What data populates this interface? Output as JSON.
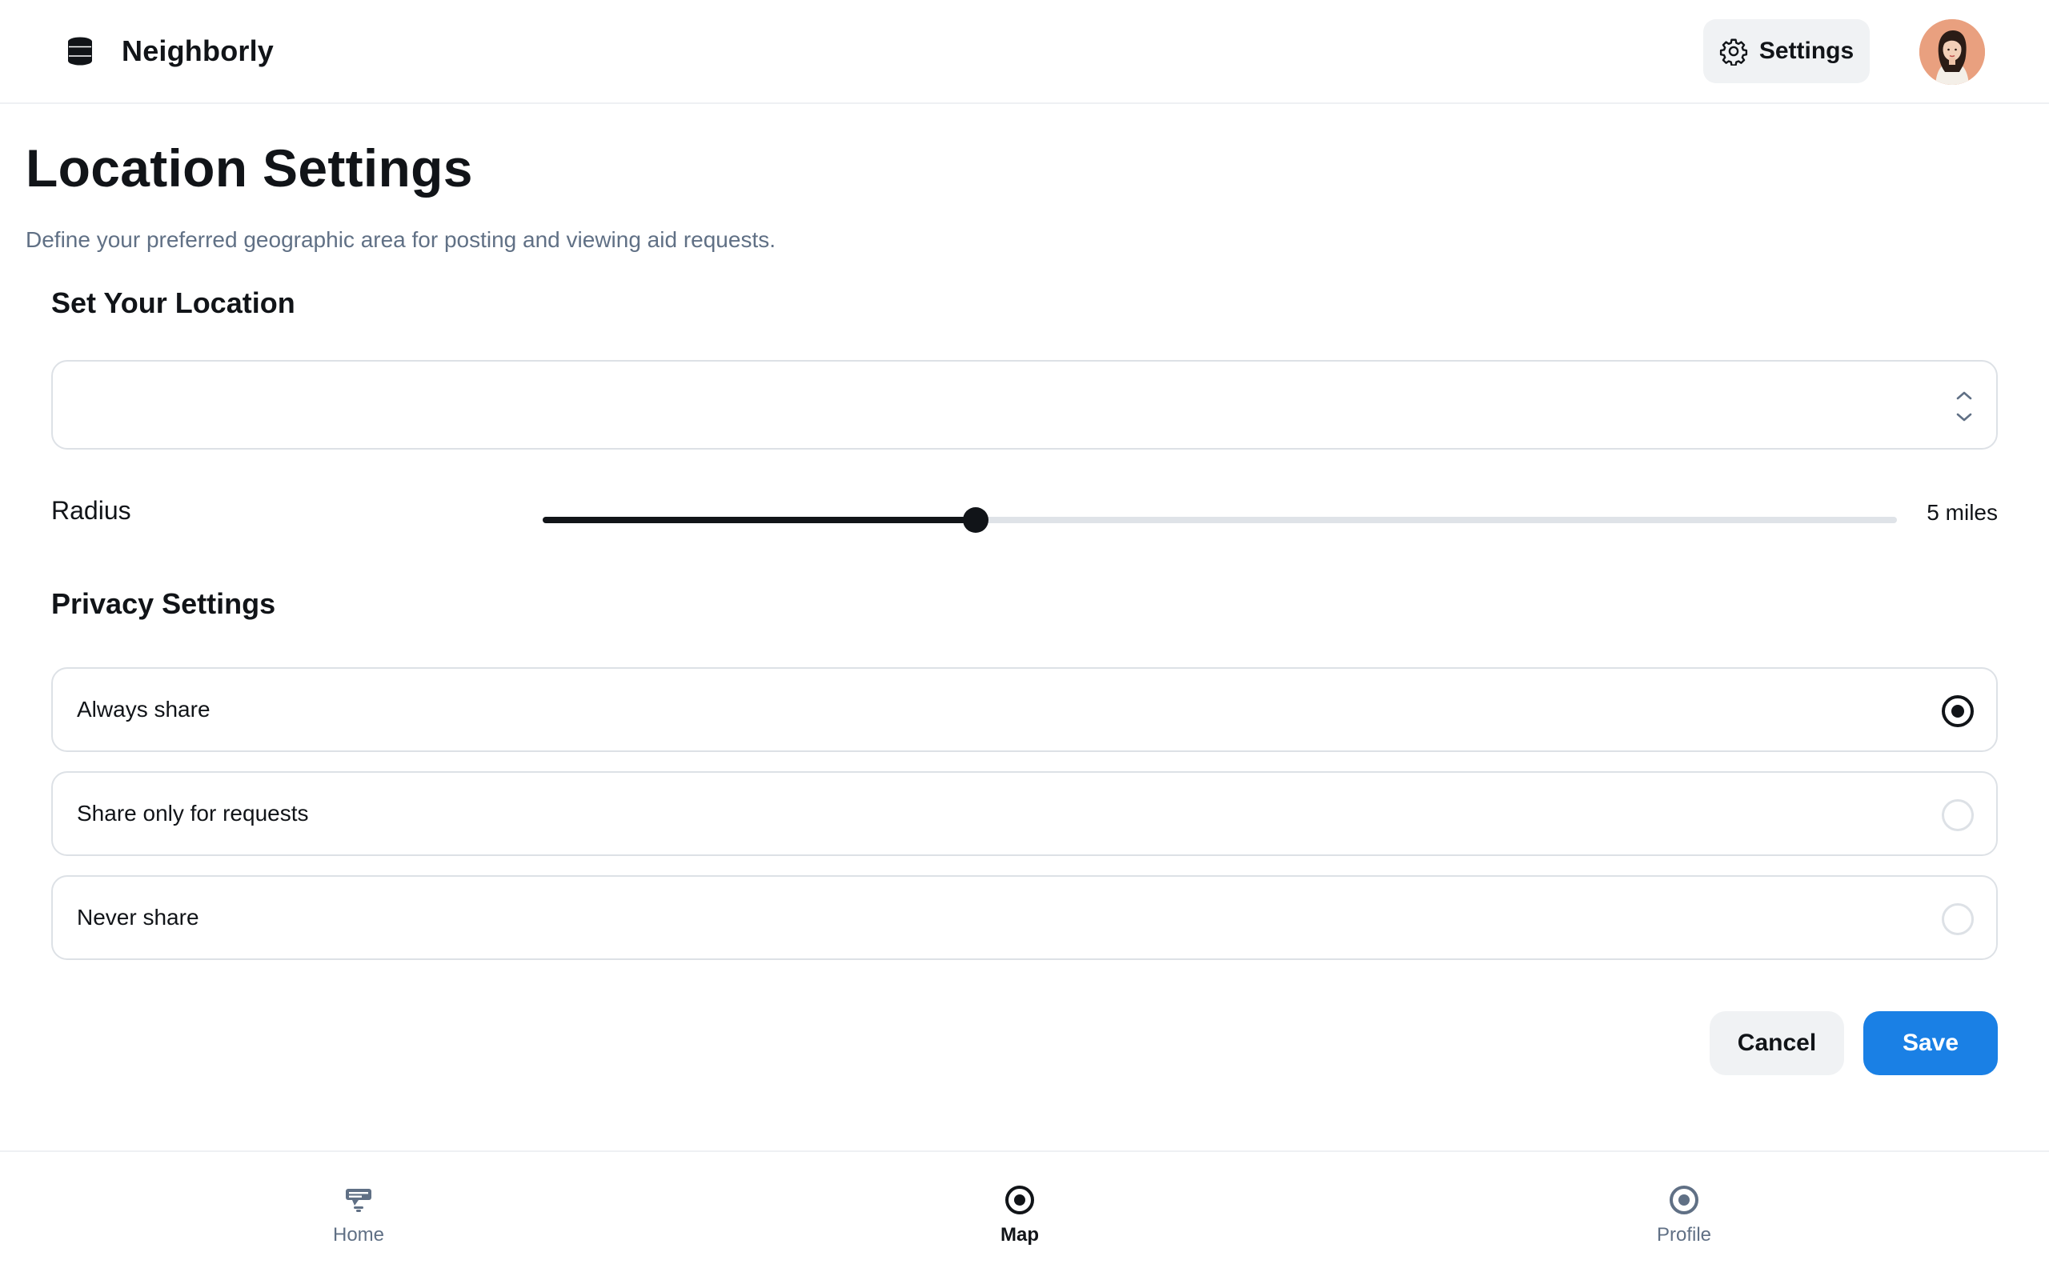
{
  "header": {
    "app_name": "Neighborly",
    "brand_icon": "stacked-layers-icon",
    "settings_label": "Settings",
    "settings_icon": "gear-icon",
    "avatar_icon": "user-avatar"
  },
  "main": {
    "title": "Location Settings",
    "subtitle": "Define your preferred geographic area for posting and viewing aid requests.",
    "location_section_title": "Set Your Location",
    "location_select": {
      "value": "",
      "icon": "chevron-up-down-icon"
    },
    "radius": {
      "label": "Radius",
      "value_text": "5 miles",
      "slider_fraction": 0.32
    },
    "privacy_section_title": "Privacy Settings",
    "privacy_options": [
      {
        "label": "Always share",
        "selected": true
      },
      {
        "label": "Share only for requests",
        "selected": false
      },
      {
        "label": "Never share",
        "selected": false
      }
    ],
    "actions": {
      "cancel_label": "Cancel",
      "save_label": "Save"
    }
  },
  "bottom_nav": {
    "items": [
      {
        "label": "Home",
        "icon": "home-icon",
        "active": false
      },
      {
        "label": "Map",
        "icon": "map-pin-icon",
        "active": true
      },
      {
        "label": "Profile",
        "icon": "profile-icon",
        "active": false
      }
    ]
  },
  "colors": {
    "primary": "#1a80e5",
    "text": "#111418",
    "muted": "#607085",
    "border": "#dde1e6"
  }
}
